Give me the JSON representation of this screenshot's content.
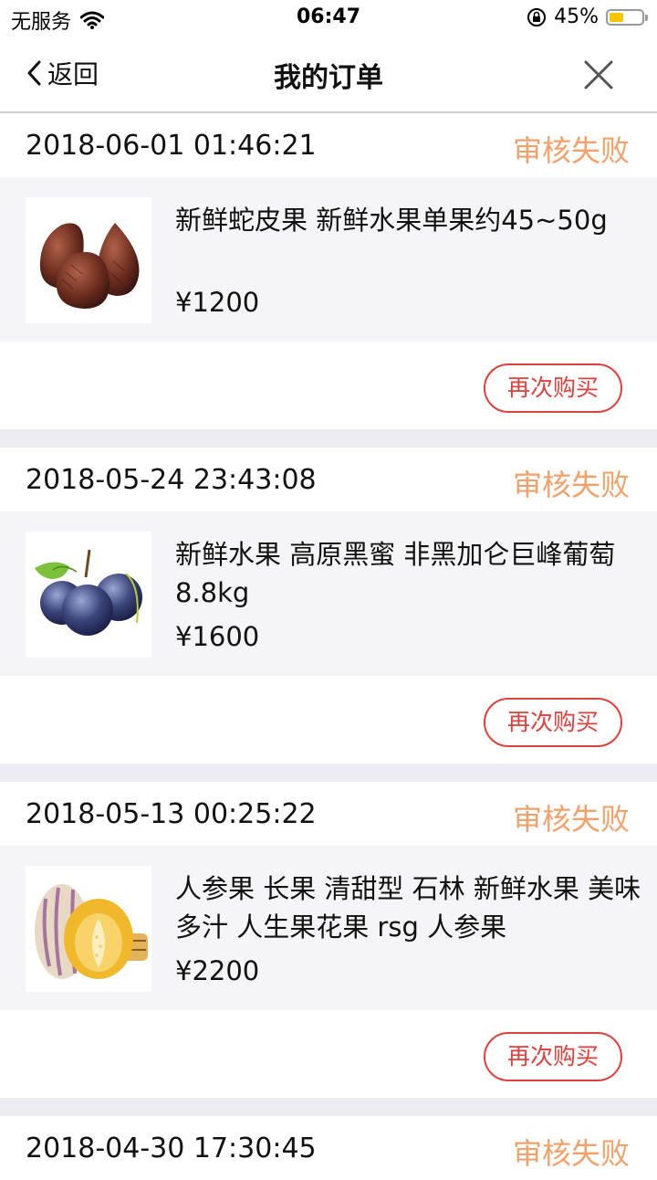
{
  "status_bar": {
    "carrier": "无服务",
    "time": "06:47",
    "battery": "45%",
    "battery_level": 0.45,
    "wifi_icon": "wifi-icon",
    "lock_icon": "rotation-lock-icon"
  },
  "nav": {
    "back_label": "返回",
    "title": "我的订单",
    "close_icon": "close-icon"
  },
  "colors": {
    "status": "#f3a16b",
    "rebuy": "#e0403c",
    "separator": "#ececf1"
  },
  "orders": [
    {
      "time": "2018-06-01 01:46:21",
      "status": "审核失败",
      "product": "新鲜蛇皮果 新鲜水果单果约45~50g",
      "price": "¥1200",
      "button": "再次购买",
      "image": "salak-fruit"
    },
    {
      "time": "2018-05-24 23:43:08",
      "status": "审核失败",
      "product": "新鲜水果 高原黑蜜 非黑加仑巨峰葡萄 8.8kg",
      "price": "¥1600",
      "button": "再次购买",
      "image": "black-grapes"
    },
    {
      "time": "2018-05-13 00:25:22",
      "status": "审核失败",
      "product": "人参果 长果 清甜型 石林 新鲜水果 美味多汁 人生果花果 rsg 人参果",
      "price": "¥2200",
      "button": "再次购买",
      "image": "pepino-melon"
    },
    {
      "time": "2018-04-30 17:30:45",
      "status": "审核失败"
    }
  ]
}
